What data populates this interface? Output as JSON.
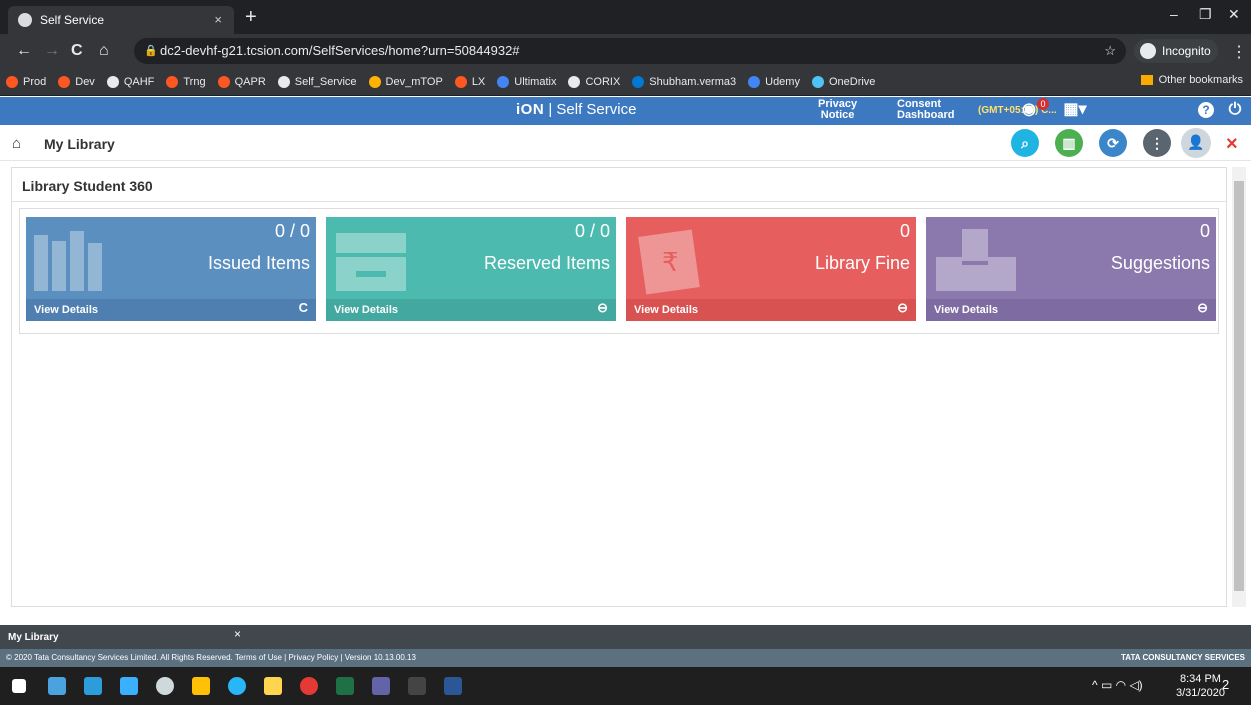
{
  "browser": {
    "tab_title": "Self Service",
    "tab_close": "×",
    "new_tab": "+",
    "url": "dc2-devhf-g21.tcsion.com/SelfServices/home?urn=50844932#",
    "incognito_label": "Incognito",
    "window_controls": [
      "–",
      "❐",
      "✕"
    ],
    "nav_icons": [
      "←",
      "→",
      "C",
      "⌂"
    ]
  },
  "bookmarks": {
    "items": [
      {
        "label": "Prod",
        "color": "#ff5722"
      },
      {
        "label": "Dev",
        "color": "#ff5722"
      },
      {
        "label": "QAHF",
        "color": "#e8eaed"
      },
      {
        "label": "Trng",
        "color": "#ff5722"
      },
      {
        "label": "QAPR",
        "color": "#ff5722"
      },
      {
        "label": "Self_Service",
        "color": "#e8eaed"
      },
      {
        "label": "Dev_mTOP",
        "color": "#ffb300"
      },
      {
        "label": "LX",
        "color": "#ff5722"
      },
      {
        "label": "Ultimatix",
        "color": "#4285f4"
      },
      {
        "label": "CORIX",
        "color": "#e8eaed"
      },
      {
        "label": "Shubham.verma3",
        "color": "#0078d4"
      },
      {
        "label": "Udemy",
        "color": "#4285f4"
      },
      {
        "label": "OneDrive",
        "color": "#4fc3f7"
      }
    ],
    "other": "Other bookmarks"
  },
  "app_header": {
    "brand_prefix": "iON",
    "brand_suffix": "| Self Service",
    "privacy_line1": "Privacy",
    "privacy_line2": "Notice",
    "consent_line1": "Consent",
    "consent_line2": "Dashboard",
    "timezone": "(GMT+05:30) C...",
    "notification_count": "0"
  },
  "page": {
    "title": "My Library",
    "close": "×"
  },
  "panel": {
    "title": "Library Student 360",
    "tiles": [
      {
        "count": "0 / 0",
        "label": "Issued Items",
        "footer": "View Details",
        "action_icon": "C",
        "color": "#5b8fbf",
        "footer_color": "#4f7fb0"
      },
      {
        "count": "0 / 0",
        "label": "Reserved Items",
        "footer": "View Details",
        "action_icon": "⊖",
        "color": "#4dbab0",
        "footer_color": "#43a8a0"
      },
      {
        "count": "0",
        "label": "Library Fine",
        "footer": "View Details",
        "action_icon": "⊖",
        "color": "#e65e5e",
        "footer_color": "#d85252"
      },
      {
        "count": "0",
        "label": "Suggestions",
        "footer": "View Details",
        "action_icon": "⊖",
        "color": "#8b79ae",
        "footer_color": "#7d6ba1"
      }
    ]
  },
  "footer": {
    "tab_label": "My Library",
    "tab_close": "×",
    "copyright": "© 2020 Tata Consultancy Services Limited. All Rights Reserved.   Terms of Use | Privacy Policy | Version 10.13.00.13",
    "brand": "TATA CONSULTANCY SERVICES"
  },
  "taskbar": {
    "time": "8:34 PM",
    "date": "3/31/2020",
    "notification_count": "2"
  }
}
